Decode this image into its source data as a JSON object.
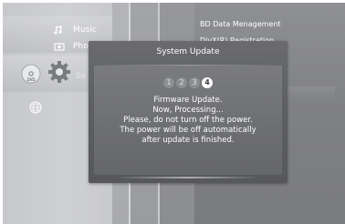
{
  "menu": {
    "music_label": "Music",
    "photo_label": "Pho",
    "settings_label": "Se"
  },
  "submenu": {
    "item_1": "BD Data Menagement",
    "item_2": "DivX(R) Registration"
  },
  "dialog": {
    "title": "System Update",
    "steps": [
      "1",
      "2",
      "3",
      "4"
    ],
    "active_step": 4,
    "messages": [
      "Firmware Update.",
      "Now, Processing...",
      "Please, do not turn off the power.",
      "The power will be off automatically",
      "after update is finished."
    ]
  },
  "colors": {
    "dialog_bg": "#5d5e61",
    "right_panel_bg": "#7f8083",
    "left_panel_bg": "#cfd0d3"
  }
}
